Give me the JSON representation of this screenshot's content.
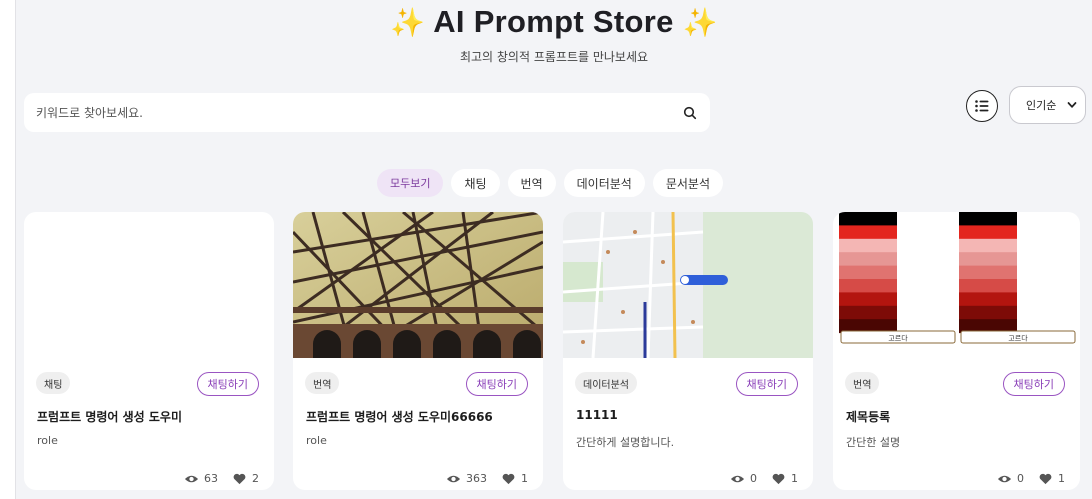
{
  "header": {
    "sparkle": "✨",
    "title": "AI Prompt Store",
    "subtitle": "최고의 창의적 프롬프트를 만나보세요"
  },
  "search": {
    "placeholder": "키워드로 찾아보세요."
  },
  "sort": {
    "selected": "인기순"
  },
  "tabs": [
    {
      "label": "모두보기",
      "active": true
    },
    {
      "label": "채팅",
      "active": false
    },
    {
      "label": "번역",
      "active": false
    },
    {
      "label": "데이터분석",
      "active": false
    },
    {
      "label": "문서분석",
      "active": false
    }
  ],
  "cards": [
    {
      "category": "채팅",
      "button": "채팅하기",
      "title": "프럼프트 명령어 생성 도우미",
      "description": "role",
      "views": "63",
      "likes": "2"
    },
    {
      "category": "번역",
      "button": "채팅하기",
      "title": "프럼프트 명령어 생성 도우미66666",
      "description": "role",
      "views": "363",
      "likes": "1"
    },
    {
      "category": "데이터분석",
      "button": "채팅하기",
      "title": "11111",
      "description": "간단하게 설명합니다.",
      "views": "0",
      "likes": "1"
    },
    {
      "category": "번역",
      "button": "채팅하기",
      "title": "제목등록",
      "description": "간단한 설명",
      "views": "0",
      "likes": "1"
    }
  ],
  "swatch": {
    "button_label": "고르다"
  },
  "colors": {
    "accent": "#8a3fb8",
    "active_tab_bg": "#efe4f6",
    "palette": [
      "#000000",
      "#e3261e",
      "#f4b6b4",
      "#e69694",
      "#e07370",
      "#d64b47",
      "#b3150f",
      "#7d0b07",
      "#4a0603"
    ]
  }
}
